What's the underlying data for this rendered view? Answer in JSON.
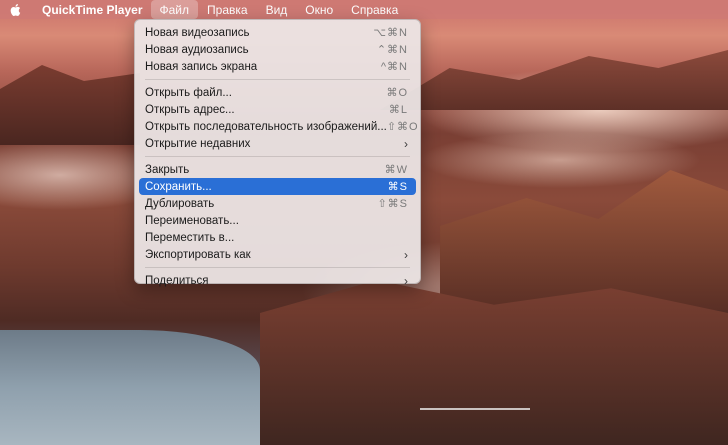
{
  "menubar": {
    "apple_icon": "apple-logo-icon",
    "app_name": "QuickTime Player",
    "items": [
      {
        "label": "Файл",
        "active": true
      },
      {
        "label": "Правка",
        "active": false
      },
      {
        "label": "Вид",
        "active": false
      },
      {
        "label": "Окно",
        "active": false
      },
      {
        "label": "Справка",
        "active": false
      }
    ]
  },
  "file_menu": {
    "groups": [
      [
        {
          "label": "Новая видеозапись",
          "shortcut": "⌥⌘N"
        },
        {
          "label": "Новая аудиозапись",
          "shortcut": "⌃⌘N"
        },
        {
          "label": "Новая запись экрана",
          "shortcut": "^⌘N"
        }
      ],
      [
        {
          "label": "Открыть файл...",
          "shortcut": "⌘O"
        },
        {
          "label": "Открыть адрес...",
          "shortcut": "⌘L"
        },
        {
          "label": "Открыть последовательность изображений...",
          "shortcut": "⇧⌘O"
        },
        {
          "label": "Открытие недавних",
          "submenu": true
        }
      ],
      [
        {
          "label": "Закрыть",
          "shortcut": "⌘W"
        },
        {
          "label": "Сохранить...",
          "shortcut": "⌘S",
          "highlighted": true
        },
        {
          "label": "Дублировать",
          "shortcut": "⇧⌘S"
        },
        {
          "label": "Переименовать..."
        },
        {
          "label": "Переместить в..."
        },
        {
          "label": "Экспортировать как",
          "submenu": true
        }
      ],
      [
        {
          "label": "Поделиться",
          "submenu": true
        }
      ]
    ],
    "submenu_icon": "chevron-right-icon",
    "highlight_color": "#2a6fd6"
  },
  "colors": {
    "menubar_bg": "#ce7a74",
    "menu_bg": "#ece6e5"
  }
}
